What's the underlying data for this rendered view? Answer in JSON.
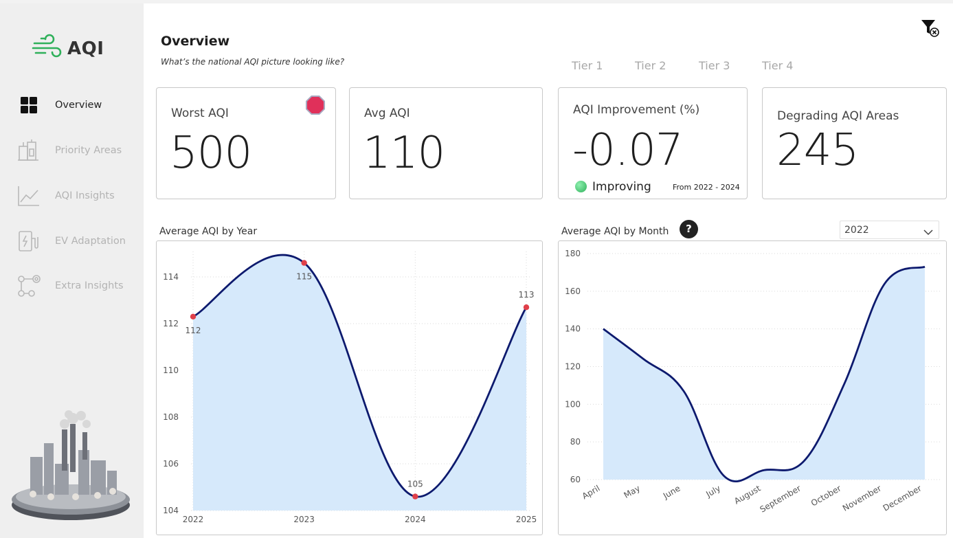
{
  "app": {
    "logo_text": "AQI"
  },
  "sidebar": {
    "items": [
      {
        "label": "Overview",
        "icon": "grid-icon",
        "active": true
      },
      {
        "label": "Priority Areas",
        "icon": "buildings-icon",
        "active": false
      },
      {
        "label": "AQI Insights",
        "icon": "line-chart-icon",
        "active": false
      },
      {
        "label": "EV Adaptation",
        "icon": "ev-charger-icon",
        "active": false
      },
      {
        "label": "Extra Insights",
        "icon": "nodes-icon",
        "active": false
      }
    ]
  },
  "header": {
    "title": "Overview",
    "subtitle": "What’s the national AQI picture looking like?",
    "tiers": [
      "Tier 1",
      "Tier 2",
      "Tier 3",
      "Tier 4"
    ]
  },
  "kpis": {
    "worst": {
      "label": "Worst AQI",
      "value": "500",
      "icon": "stop-sign-icon"
    },
    "avg": {
      "label": "Avg AQI",
      "value": "110"
    },
    "improvement": {
      "label": "AQI Improvement (%)",
      "value": "-0.07",
      "status": "Improving",
      "period": "From 2022 - 2024"
    },
    "degrading": {
      "label": "Degrading AQI Areas",
      "value": "245"
    }
  },
  "colors": {
    "line": "#0d1a6e",
    "area": "#d6e9fb",
    "marker": "#e0404a",
    "improving": "#2fb05a"
  },
  "year_filter": {
    "selected": "2022"
  },
  "chart_data": [
    {
      "type": "area",
      "title": "Average AQI by Year",
      "x": [
        "2022",
        "2023",
        "2024",
        "2025"
      ],
      "values": [
        112.3,
        114.6,
        104.6,
        112.7
      ],
      "data_labels": [
        "112",
        "115",
        "105",
        "113"
      ],
      "ylim": [
        104,
        115
      ],
      "yticks": [
        "104",
        "106",
        "108",
        "110",
        "112",
        "114"
      ],
      "grid": true
    },
    {
      "type": "area",
      "title": "Average AQI by Month",
      "x": [
        "April",
        "May",
        "June",
        "July",
        "August",
        "September",
        "October",
        "November",
        "December"
      ],
      "values": [
        140,
        124,
        107,
        62,
        65,
        70,
        111,
        164,
        173
      ],
      "ylim": [
        60,
        180
      ],
      "yticks": [
        "60",
        "80",
        "100",
        "120",
        "140",
        "160",
        "180"
      ],
      "grid": true
    }
  ]
}
